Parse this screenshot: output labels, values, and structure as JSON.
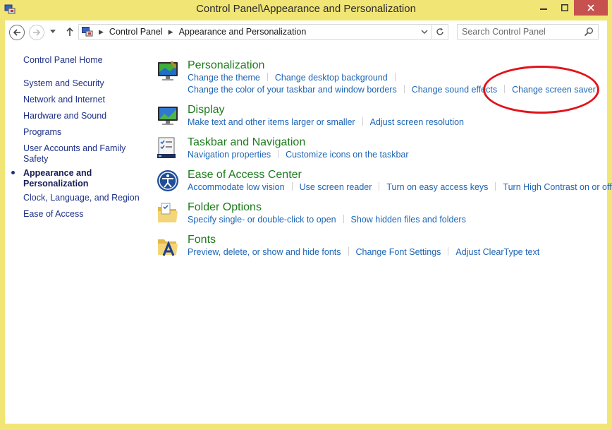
{
  "window": {
    "title": "Control Panel\\Appearance and Personalization"
  },
  "address_bar": {
    "crumbs": [
      "Control Panel",
      "Appearance and Personalization"
    ]
  },
  "search": {
    "placeholder": "Search Control Panel"
  },
  "sidebar": {
    "items": [
      {
        "label": "Control Panel Home"
      },
      {
        "label": "System and Security"
      },
      {
        "label": "Network and Internet"
      },
      {
        "label": "Hardware and Sound"
      },
      {
        "label": "Programs"
      },
      {
        "label": "User Accounts and Family Safety"
      },
      {
        "label": "Appearance and Personalization",
        "current": true
      },
      {
        "label": "Clock, Language, and Region"
      },
      {
        "label": "Ease of Access"
      }
    ]
  },
  "categories": {
    "personalization": {
      "title": "Personalization",
      "icon": "personalization-icon",
      "links": [
        "Change the theme",
        "Change desktop background",
        "Change the color of your taskbar and window borders",
        "Change sound effects",
        "Change screen saver"
      ]
    },
    "display": {
      "title": "Display",
      "icon": "display-icon",
      "links": [
        "Make text and other items larger or smaller",
        "Adjust screen resolution"
      ]
    },
    "taskbar": {
      "title": "Taskbar and Navigation",
      "icon": "taskbar-icon",
      "links": [
        "Navigation properties",
        "Customize icons on the taskbar"
      ]
    },
    "ease": {
      "title": "Ease of Access Center",
      "icon": "ease-of-access-icon",
      "links": [
        "Accommodate low vision",
        "Use screen reader",
        "Turn on easy access keys",
        "Turn High Contrast on or off"
      ]
    },
    "folder": {
      "title": "Folder Options",
      "icon": "folder-options-icon",
      "links": [
        "Specify single- or double-click to open",
        "Show hidden files and folders"
      ]
    },
    "fonts": {
      "title": "Fonts",
      "icon": "fonts-icon",
      "links": [
        "Preview, delete, or show and hide fonts",
        "Change Font Settings",
        "Adjust ClearType text"
      ]
    }
  },
  "colors": {
    "window_frame": "#f1e576",
    "close_button": "#c7514f",
    "category_title": "#1e7b1e",
    "link": "#1c64b4",
    "sidebar_link": "#1e3287",
    "annotation": "#e0141c"
  }
}
